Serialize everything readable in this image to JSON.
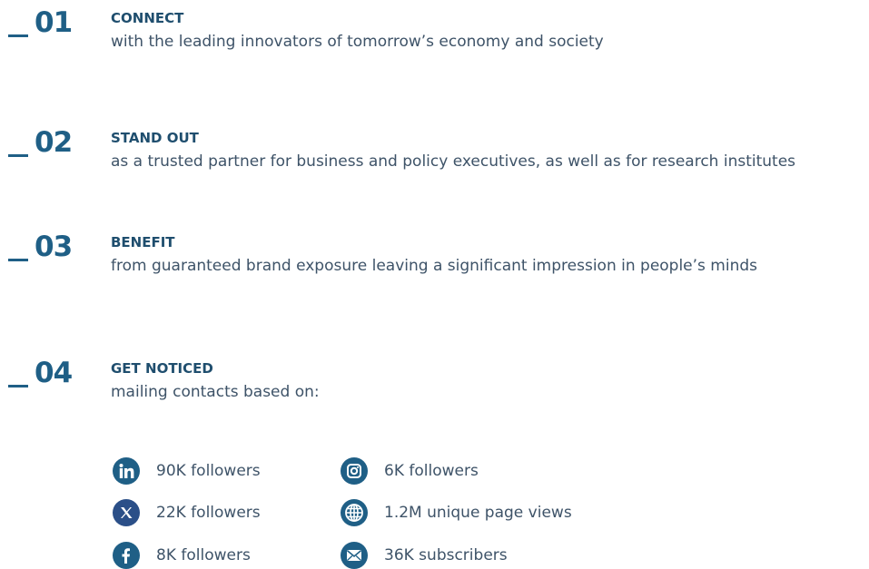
{
  "items": [
    {
      "number": "01",
      "heading": "CONNECT",
      "description": "with the leading innovators of tomorrow’s economy and society"
    },
    {
      "number": "02",
      "heading": "STAND OUT",
      "description": "as a trusted partner for business and policy executives, as well as for research institutes"
    },
    {
      "number": "03",
      "heading": "BENEFIT",
      "description": "from guaranteed brand exposure leaving a significant impression in people’s minds"
    },
    {
      "number": "04",
      "heading": "GET NOTICED",
      "description": "mailing contacts based on:"
    }
  ],
  "social": {
    "linkedin": {
      "icon": "linkedin-icon",
      "text": "90K followers"
    },
    "twitter": {
      "icon": "x-icon",
      "text": "22K followers"
    },
    "facebook": {
      "icon": "facebook-icon",
      "text": "8K followers"
    },
    "instagram": {
      "icon": "instagram-icon",
      "text": "6K followers"
    },
    "web": {
      "icon": "globe-icon",
      "text": "1.2M unique page views"
    },
    "newsletter": {
      "icon": "mail-icon",
      "text": "36K subscribers"
    }
  },
  "colors": {
    "accent": "#1f5f86",
    "text": "#3e5368"
  }
}
